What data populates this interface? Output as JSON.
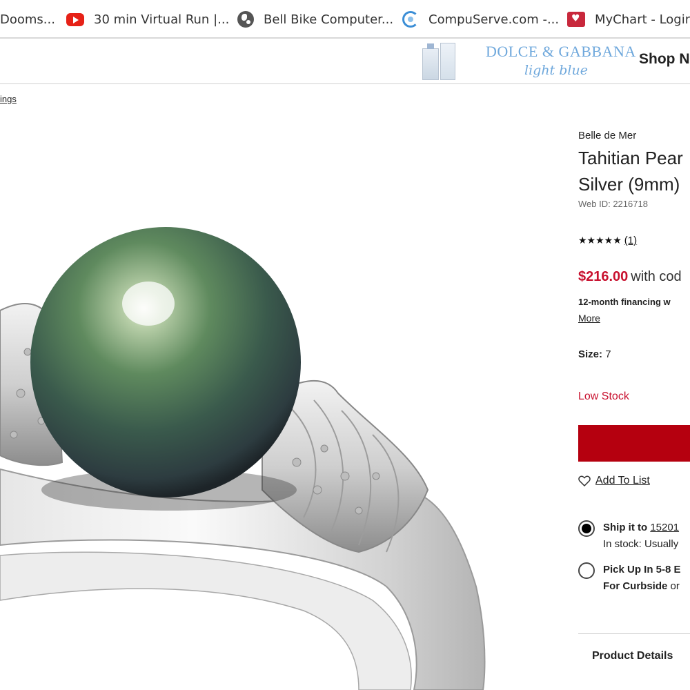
{
  "bookmarks": [
    {
      "label": "Dooms...",
      "icon": "none"
    },
    {
      "label": "30 min Virtual Run |...",
      "icon": "youtube-icon"
    },
    {
      "label": "Bell Bike Computer...",
      "icon": "globe-icon"
    },
    {
      "label": "CompuServe.com -...",
      "icon": "compuserve-icon"
    },
    {
      "label": "MyChart - Login",
      "icon": "mychart-icon"
    }
  ],
  "ad": {
    "brand": "DOLCE & GABBANA",
    "brand_sub": "light blue",
    "cta": "Shop N"
  },
  "breadcrumb": "ings",
  "product": {
    "brand": "Belle de Mer",
    "title_line1": "Tahitian Pear",
    "title_line2": "Silver (9mm)",
    "web_id": "Web ID: 2216718",
    "stars": "★★★★★",
    "review_count": "(1)",
    "rating": 5,
    "price": "$216.00",
    "price_suffix": "with cod",
    "financing": "12-month financing w",
    "more_link": "More",
    "size_label": "Size:",
    "size_value": "7",
    "stock_status": "Low Stock",
    "add_to_list": "Add To List",
    "ship_label": "Ship it to",
    "ship_zip": "15201",
    "ship_stock": "In stock: Usually",
    "pickup_label": "Pick Up In 5-8 E",
    "pickup_sub_bold": "For Curbside",
    "pickup_sub_tail": "or",
    "details_tab": "Product Details"
  },
  "colors": {
    "accent_red": "#c8102e",
    "button_red": "#b5000f",
    "brand_blue": "#6fa8dc"
  }
}
